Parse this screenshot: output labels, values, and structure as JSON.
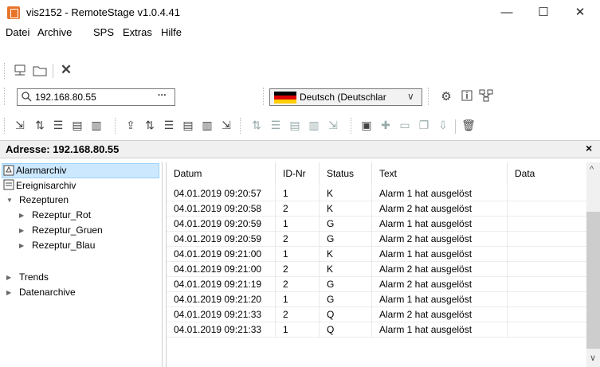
{
  "window": {
    "title": "vis2152 - RemoteStage v1.0.4.41",
    "minimize": "—",
    "maximize": "☐",
    "close": "✕"
  },
  "menu": {
    "items": [
      {
        "label": "Datei"
      },
      {
        "label": "Archive"
      },
      {
        "label": "SPS"
      },
      {
        "label": "Extras"
      },
      {
        "label": "Hilfe"
      }
    ]
  },
  "toolbar": {
    "address_value": "192.168.80.55",
    "address_more": "···",
    "language_value": "Deutsch (Deutschlar",
    "language_arrow": "∨"
  },
  "address_header": {
    "label": "Adresse: 192.168.80.55",
    "close": "×"
  },
  "tree": {
    "items": [
      {
        "label": "Alarmarchiv",
        "icon": "alarm-icon",
        "level": 0
      },
      {
        "label": "Ereignisarchiv",
        "icon": "event-icon",
        "level": 0
      },
      {
        "label": "Rezepturen",
        "level": 0,
        "expanded": true
      },
      {
        "label": "Rezeptur_Rot",
        "level": 1
      },
      {
        "label": "Rezeptur_Gruen",
        "level": 1
      },
      {
        "label": "Rezeptur_Blau",
        "level": 1
      },
      {
        "label": "Trends",
        "level": 0
      },
      {
        "label": "Datenarchive",
        "level": 0
      }
    ]
  },
  "table": {
    "columns": [
      "Datum",
      "ID-Nr",
      "Status",
      "Text",
      "Data"
    ],
    "rows": [
      [
        "04.01.2019 09:20:57",
        "1",
        "K",
        "Alarm 1 hat ausgelöst",
        ""
      ],
      [
        "04.01.2019 09:20:58",
        "2",
        "K",
        "Alarm 2 hat ausgelöst",
        ""
      ],
      [
        "04.01.2019 09:20:59",
        "1",
        "G",
        "Alarm 1 hat ausgelöst",
        ""
      ],
      [
        "04.01.2019 09:20:59",
        "2",
        "G",
        "Alarm 2 hat ausgelöst",
        ""
      ],
      [
        "04.01.2019 09:21:00",
        "1",
        "K",
        "Alarm 1 hat ausgelöst",
        ""
      ],
      [
        "04.01.2019 09:21:00",
        "2",
        "K",
        "Alarm 2 hat ausgelöst",
        ""
      ],
      [
        "04.01.2019 09:21:19",
        "2",
        "G",
        "Alarm 2 hat ausgelöst",
        ""
      ],
      [
        "04.01.2019 09:21:20",
        "1",
        "G",
        "Alarm 1 hat ausgelöst",
        ""
      ],
      [
        "04.01.2019 09:21:33",
        "2",
        "Q",
        "Alarm 2 hat ausgelöst",
        ""
      ],
      [
        "04.01.2019 09:21:33",
        "1",
        "Q",
        "Alarm 1 hat ausgelöst",
        ""
      ]
    ]
  },
  "scrollbar": {
    "up": "^",
    "down": "∨"
  },
  "colors": {
    "selection": "#cce8ff",
    "selection_border": "#99d1ff",
    "flag_black": "#000000",
    "flag_red": "#dd0000",
    "flag_gold": "#ffce00",
    "app_icon": "#e8742a"
  }
}
